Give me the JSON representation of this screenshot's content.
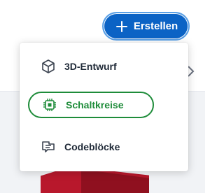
{
  "header": {
    "create_button_label": "Erstellen",
    "create_button_icon": "plus-icon"
  },
  "menu": {
    "items": [
      {
        "label": "3D-Entwurf",
        "icon": "cube-icon",
        "selected": false
      },
      {
        "label": "Schaltkreise",
        "icon": "circuit-chip-icon",
        "selected": true
      },
      {
        "label": "Codeblöcke",
        "icon": "code-blocks-icon",
        "selected": false
      }
    ]
  },
  "colors": {
    "primary_button": "#0b63c5",
    "selected_item": "#1e8c3a",
    "background_object": "#b8182c"
  }
}
